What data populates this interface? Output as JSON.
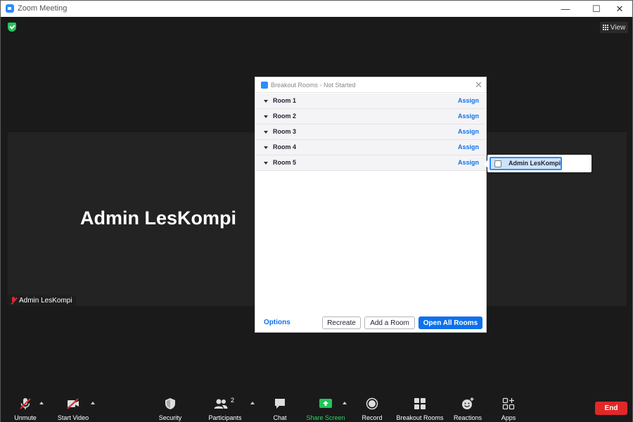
{
  "window": {
    "title": "Zoom Meeting",
    "minimize": "—",
    "maximize": "☐",
    "close": "✕"
  },
  "header": {
    "view_label": "View"
  },
  "video": {
    "speaker_name": "Admin LesKompi",
    "name_tag": "Admin LesKompi"
  },
  "breakout": {
    "title": "Breakout Rooms - Not Started",
    "close": "✕",
    "rooms": [
      {
        "name": "Room 1",
        "action": "Assign"
      },
      {
        "name": "Room 2",
        "action": "Assign"
      },
      {
        "name": "Room 3",
        "action": "Assign"
      },
      {
        "name": "Room 4",
        "action": "Assign"
      },
      {
        "name": "Room 5",
        "action": "Assign"
      }
    ],
    "options_label": "Options",
    "recreate_label": "Recreate",
    "add_room_label": "Add a Room",
    "open_all_label": "Open All Rooms"
  },
  "assign_popover": {
    "participant": "Admin LesKompi"
  },
  "toolbar": {
    "unmute": "Unmute",
    "start_video": "Start Video",
    "security": "Security",
    "participants": "Participants",
    "participants_count": "2",
    "chat": "Chat",
    "share_screen": "Share Screen",
    "record": "Record",
    "breakout_rooms": "Breakout Rooms",
    "reactions": "Reactions",
    "apps": "Apps",
    "end": "End"
  },
  "colors": {
    "accent_blue": "#0e71eb",
    "share_green": "#23c45a",
    "end_red": "#e02828",
    "background": "#1a1a1a"
  }
}
